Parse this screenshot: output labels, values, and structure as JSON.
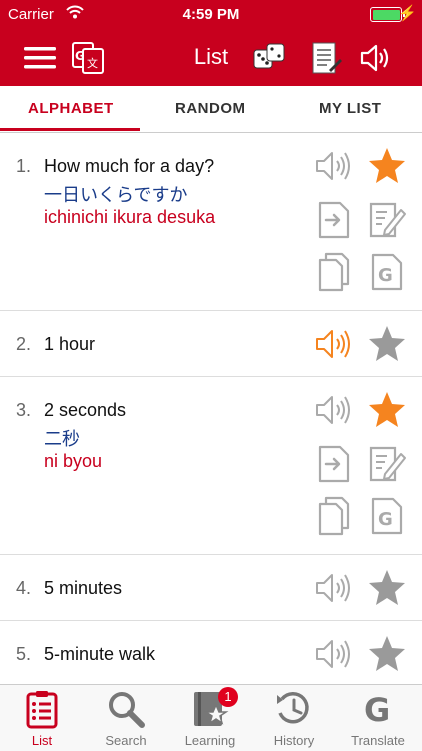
{
  "status": {
    "carrier": "Carrier",
    "time": "4:59 PM"
  },
  "nav": {
    "title": "List"
  },
  "segments": [
    "ALPHABET",
    "RANDOM",
    "MY LIST"
  ],
  "items": [
    {
      "num": "1.",
      "english": "How much for a day?",
      "japanese": "一日いくらですか",
      "romaji": "ichinichi ikura desuka",
      "starred": true,
      "speaker_active": false
    },
    {
      "num": "2.",
      "english": "1 hour",
      "starred": false,
      "speaker_active": true
    },
    {
      "num": "3.",
      "english": "2 seconds",
      "japanese": "二秒",
      "romaji": "ni byou",
      "starred": true,
      "speaker_active": false
    },
    {
      "num": "4.",
      "english": "5 minutes",
      "starred": false,
      "speaker_active": false
    },
    {
      "num": "5.",
      "english": "5-minute walk",
      "starred": false,
      "speaker_active": false
    }
  ],
  "tabs": [
    {
      "label": "List",
      "icon": "clipboard-list-icon",
      "active": true
    },
    {
      "label": "Search",
      "icon": "magnifier-icon"
    },
    {
      "label": "Learning",
      "icon": "book-star-icon",
      "badge": "1"
    },
    {
      "label": "History",
      "icon": "clock-history-icon"
    },
    {
      "label": "Translate",
      "icon": "google-g-icon"
    }
  ],
  "colors": {
    "brand_red": "#c8001e",
    "accent_orange": "#f5841f",
    "star_gray": "#9a9a9a",
    "japanese_blue": "#1a3c8a"
  }
}
